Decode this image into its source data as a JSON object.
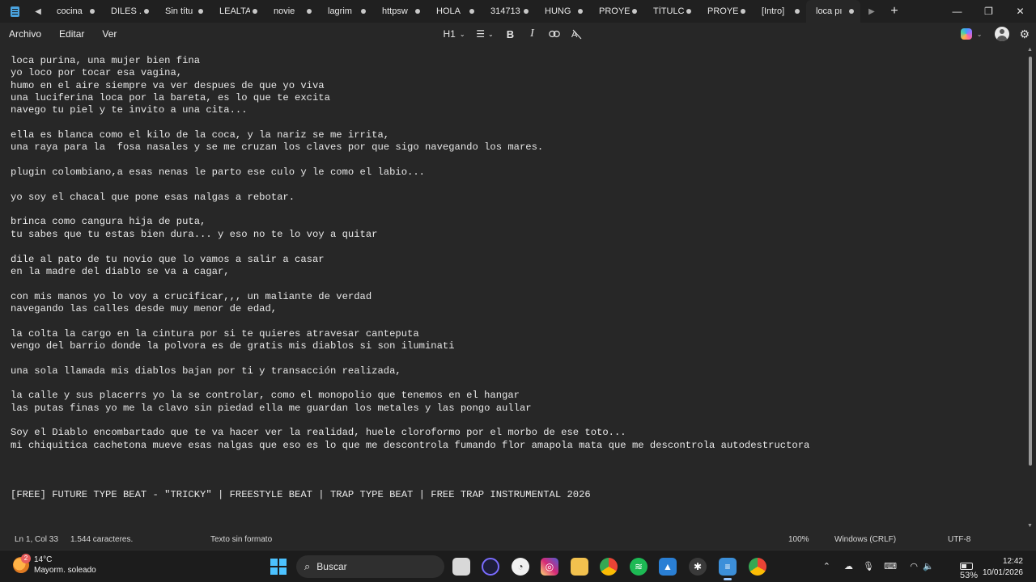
{
  "tabs": [
    {
      "label": "cocina"
    },
    {
      "label": "DILES ."
    },
    {
      "label": "Sin títu"
    },
    {
      "label": "LEALTA"
    },
    {
      "label": "novie"
    },
    {
      "label": "lagrim"
    },
    {
      "label": "httpsw"
    },
    {
      "label": "HOLA"
    },
    {
      "label": "314713"
    },
    {
      "label": "HUNG"
    },
    {
      "label": "PROYE"
    },
    {
      "label": "TÍTULC"
    },
    {
      "label": "PROYE"
    },
    {
      "label": "[Intro]"
    },
    {
      "label": "loca pı",
      "active": true
    }
  ],
  "menu": {
    "file": "Archivo",
    "edit": "Editar",
    "view": "Ver"
  },
  "format": {
    "heading": "H1",
    "bold": "B",
    "italic": "I"
  },
  "editor": {
    "lines": [
      "loca purina, una mujer bien fina",
      "yo loco por tocar esa vagina,",
      "humo en el aire siempre va ver despues de que yo viva",
      "una luciferina loca por la bareta, es lo que te excita",
      "navego tu piel y te invito a una cita...",
      "",
      "ella es blanca como el kilo de la coca, y la nariz se me irrita,",
      "una raya para la  fosa nasales y se me cruzan los claves por que sigo navegando los mares.",
      "",
      "plugin colombiano,a esas nenas le parto ese culo y le como el labio...",
      "",
      "yo soy el chacal que pone esas nalgas a rebotar.",
      "",
      "brinca como cangura hija de puta,",
      "tu sabes que tu estas bien dura... y eso no te lo voy a quitar",
      "",
      "dile al pato de tu novio que lo vamos a salir a casar",
      "en la madre del diablo se va a cagar,",
      "",
      "con mis manos yo lo voy a crucificar,,, un maliante de verdad",
      "navegando las calles desde muy menor de edad,",
      "",
      "la colta la cargo en la cintura por si te quieres atravesar canteputa",
      "vengo del barrio donde la polvora es de gratis mis diablos si son iluminati",
      "",
      "una sola llamada mis diablos bajan por ti y transacción realizada,",
      "",
      "la calle y sus placerrs yo la se controlar, como el monopolio que tenemos en el hangar",
      "las putas finas yo me la clavo sin piedad ella me guardan los metales y las pongo aullar",
      "",
      "Soy el Diablo encombartado que te va hacer ver la realidad, huele cloroformo por el morbo de ese toto...",
      "mi chiquitica cachetona mueve esas nalgas que eso es lo que me descontrola fumando flor amapola mata que me descontrola autodestructora",
      "",
      "",
      "",
      "[FREE] FUTURE TYPE BEAT - \"TRICKY\" | FREESTYLE BEAT | TRAP TYPE BEAT | FREE TRAP INSTRUMENTAL 2026"
    ]
  },
  "status": {
    "position": "Ln 1, Col 33",
    "chars": "1.544 caracteres.",
    "format": "Texto sin formato",
    "zoom": "100%",
    "line_ending": "Windows (CRLF)",
    "encoding": "UTF-8"
  },
  "taskbar": {
    "weather_temp": "14°C",
    "weather_desc": "Mayorm. soleado",
    "weather_badge": "2",
    "search_placeholder": "Buscar",
    "battery": "53%",
    "battery_level": 0.53,
    "time": "12:42",
    "date": "10/01/2026"
  },
  "colors": {
    "background": "#272727",
    "titlebar": "#202020",
    "taskbar": "#1c1c1c",
    "accent": "#4cc2ff"
  }
}
